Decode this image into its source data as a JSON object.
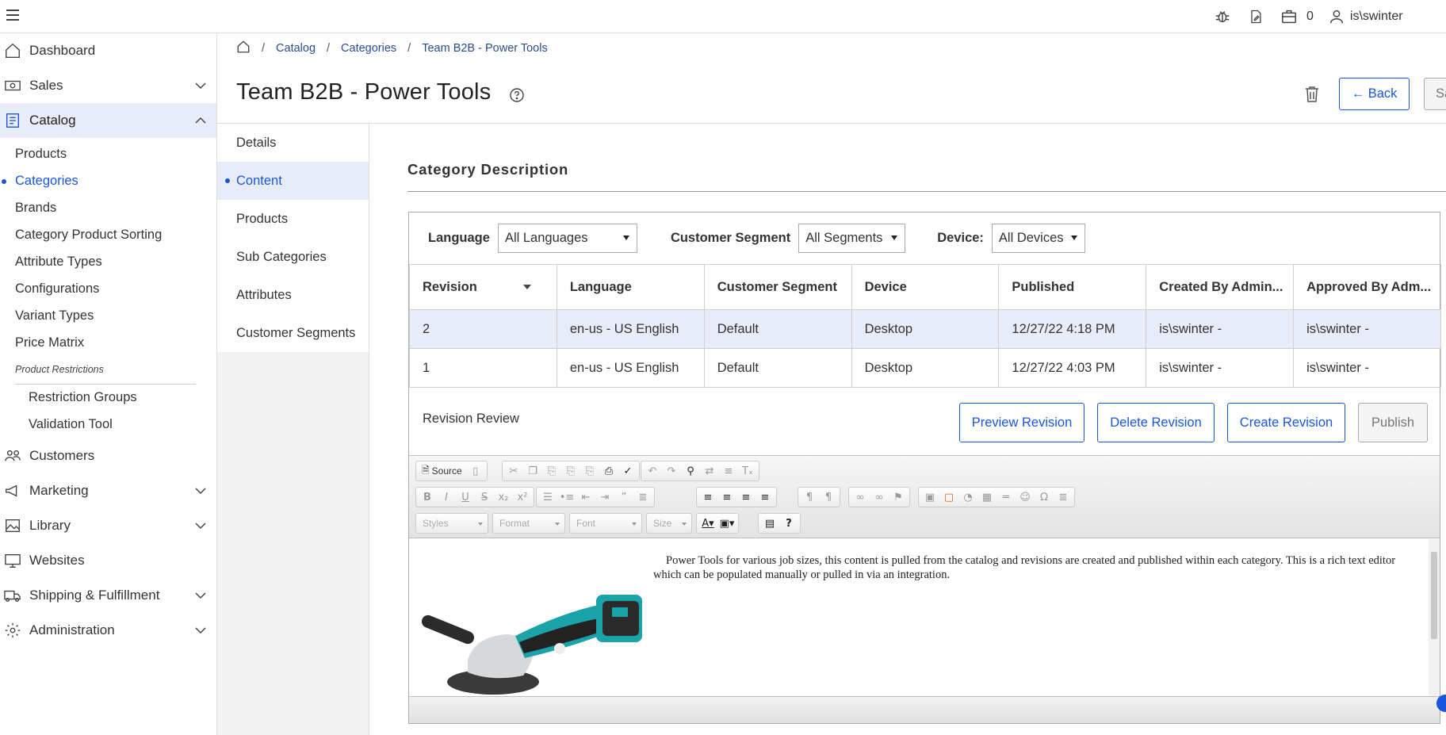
{
  "topbar": {
    "cart_count": "0",
    "username": "is\\swinter",
    "icons": [
      "menu-icon",
      "bug-icon",
      "document-edit-icon",
      "briefcase-icon",
      "user-icon"
    ]
  },
  "sidebar": {
    "items": [
      {
        "label": "Dashboard",
        "icon": "home-icon"
      },
      {
        "label": "Sales",
        "icon": "money-icon"
      },
      {
        "label": "Catalog",
        "icon": "book-icon"
      },
      {
        "label": "Customers",
        "icon": "people-icon"
      },
      {
        "label": "Marketing",
        "icon": "megaphone-icon"
      },
      {
        "label": "Library",
        "icon": "image-icon"
      },
      {
        "label": "Websites",
        "icon": "monitor-icon"
      },
      {
        "label": "Shipping & Fulfillment",
        "icon": "truck-icon"
      },
      {
        "label": "Administration",
        "icon": "gear-icon"
      }
    ],
    "catalog_sub": [
      "Products",
      "Categories",
      "Brands",
      "Category Product Sorting",
      "Attribute Types",
      "Configurations",
      "Variant Types",
      "Price Matrix"
    ],
    "restrictions_heading": "Product Restrictions",
    "restrictions_sub": [
      "Restriction Groups",
      "Validation Tool"
    ]
  },
  "breadcrumb": {
    "catalog": "Catalog",
    "categories": "Categories",
    "current": "Team B2B - Power Tools",
    "sep": "/"
  },
  "header": {
    "title": "Team B2B - Power Tools",
    "back_label": "← Back",
    "save_label": "Sa"
  },
  "submenu": [
    "Details",
    "Content",
    "Products",
    "Sub Categories",
    "Attributes",
    "Customer Segments"
  ],
  "content": {
    "section_title": "Category Description",
    "filters": {
      "language_label": "Language",
      "language_value": "All Languages",
      "segment_label": "Customer Segment",
      "segment_value": "All Segments",
      "device_label": "Device:",
      "device_value": "All Devices"
    },
    "table": {
      "headers": [
        "Revision",
        "Language",
        "Customer Segment",
        "Device",
        "Published",
        "Created By Admin...",
        "Approved By Adm..."
      ],
      "rows": [
        [
          "2",
          "en-us - US English",
          "Default",
          "Desktop",
          "12/27/22 4:18 PM",
          "is\\swinter -",
          "is\\swinter -"
        ],
        [
          "1",
          "en-us - US English",
          "Default",
          "Desktop",
          "12/27/22 4:03 PM",
          "is\\swinter -",
          "is\\swinter -"
        ]
      ]
    },
    "revision_review_label": "Revision Review",
    "buttons": {
      "preview": "Preview Revision",
      "delete": "Delete Revision",
      "create": "Create Revision",
      "publish": "Publish"
    },
    "editor": {
      "source_label": "Source",
      "combos": [
        "Styles",
        "Format",
        "Font",
        "Size"
      ],
      "text": "Power Tools for various job sizes, this content is pulled from the catalog and revisions are created and published within each category. This is a rich text editor which can be populated manually or pulled in via an integration.",
      "image_alt": "angle grinder"
    }
  },
  "colors": {
    "accent": "#1a56db",
    "active_bg": "#e8ecf8",
    "tool_teal": "#1aa3a8"
  }
}
